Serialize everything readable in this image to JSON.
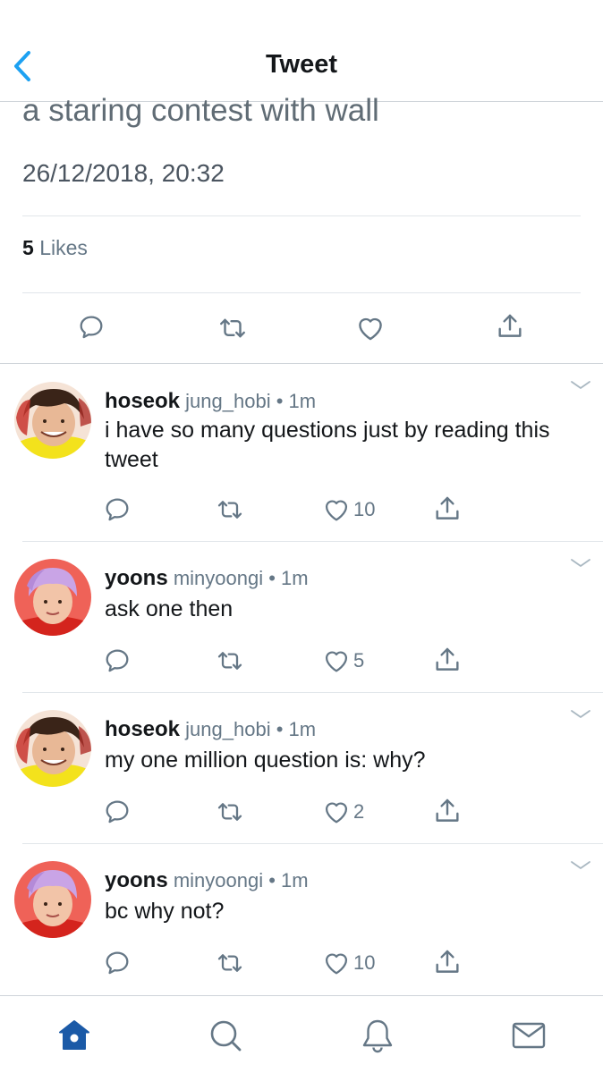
{
  "header": {
    "title": "Tweet",
    "back_icon": "chevron-left-icon"
  },
  "tweet": {
    "text": "a staring contest with wall",
    "timestamp": "26/12/2018, 20:32",
    "likes_count": "5",
    "likes_label": "Likes"
  },
  "replies": [
    {
      "name": "hoseok",
      "handle": "jung_hobi",
      "dot": "•",
      "time": "1m",
      "text": "i have so many questions just by reading this tweet",
      "like_count": "10"
    },
    {
      "name": "yoons",
      "handle": "minyoongi",
      "dot": "•",
      "time": "1m",
      "text": "ask one then",
      "like_count": "5"
    },
    {
      "name": "hoseok",
      "handle": "jung_hobi",
      "dot": "•",
      "time": "1m",
      "text": "my one million question is: why?",
      "like_count": "2"
    },
    {
      "name": "yoons",
      "handle": "minyoongi",
      "dot": "•",
      "time": "1m",
      "text": "bc why not?",
      "like_count": "10"
    }
  ],
  "tabbar": {
    "items": [
      "home-icon",
      "search-icon",
      "notifications-icon",
      "messages-icon"
    ],
    "active": "home-icon"
  },
  "colors": {
    "accent": "#1da1f2",
    "icon": "#657786",
    "active_tab": "#1b5aa7"
  }
}
